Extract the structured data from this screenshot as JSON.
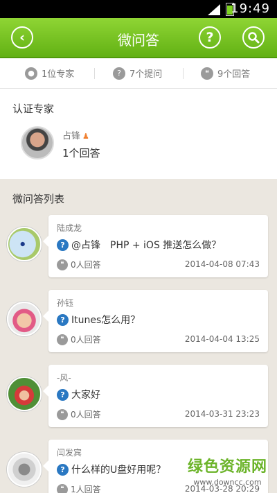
{
  "status_bar": {
    "time": "19:49"
  },
  "header": {
    "title": "微问答",
    "back_icon": "back-icon",
    "help_icon": "help-icon",
    "search_icon": "search-icon"
  },
  "stats": [
    {
      "icon": "person-icon",
      "label": "1位专家"
    },
    {
      "icon": "question-icon",
      "label": "7个提问"
    },
    {
      "icon": "quote-icon",
      "label": "9个回答"
    }
  ],
  "expert_section": {
    "title": "认证专家",
    "expert": {
      "name": "占锋",
      "answers": "1个回答"
    }
  },
  "list_section": {
    "title": "微问答列表"
  },
  "questions": [
    {
      "author": "陆成龙",
      "question": "@占锋　PHP + iOS 推送怎么做？",
      "answers": "0人回答",
      "date": "2014-04-08 07:43"
    },
    {
      "author": "孙钰",
      "question": "Itunes怎么用？",
      "answers": "0人回答",
      "date": "2014-04-04 13:25"
    },
    {
      "author": "-风-",
      "question": "大家好",
      "answers": "0人回答",
      "date": "2014-03-31 23:23"
    },
    {
      "author": "闫发宾",
      "question": "什么样的U盘好用呢？",
      "answers": "1人回答",
      "date": "2014-03-28 20:29"
    }
  ],
  "watermark": {
    "line1": "绿色资源网",
    "line2": "www.downcc.com"
  },
  "colors": {
    "header_green": "#6dba1e",
    "question_blue": "#2a78c2",
    "background": "#ebe7e0"
  }
}
